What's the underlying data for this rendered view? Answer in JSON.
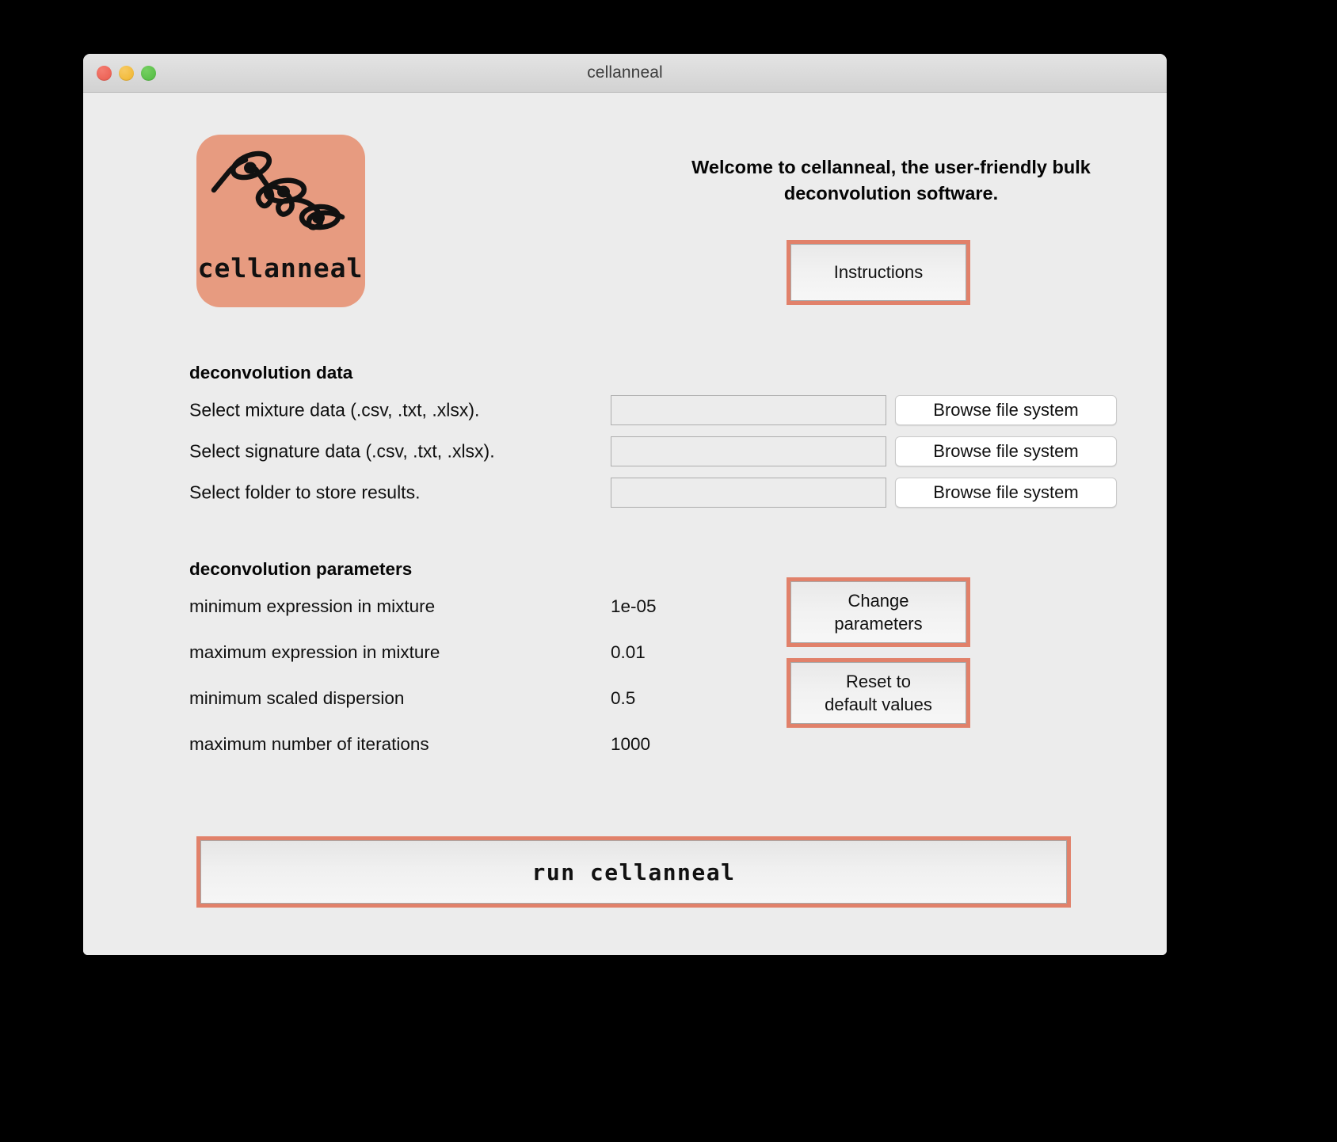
{
  "window": {
    "title": "cellanneal",
    "traffic_lights": [
      {
        "name": "close",
        "color": "#e9594c"
      },
      {
        "name": "minimize",
        "color": "#f0b429"
      },
      {
        "name": "zoom",
        "color": "#4fb93f"
      }
    ]
  },
  "logo": {
    "caption": "cellanneal",
    "background_color": "#e79b80",
    "ink_color": "#111111"
  },
  "welcome": {
    "text": "Welcome to cellanneal, the user-friendly bulk deconvolution software."
  },
  "buttons": {
    "instructions": "Instructions",
    "change_parameters": "Change\nparameters",
    "reset_defaults": "Reset to\ndefault values",
    "run": "run cellanneal",
    "browse": "Browse file system"
  },
  "sections": {
    "data_heading": "deconvolution data",
    "parameters_heading": "deconvolution parameters"
  },
  "data_rows": [
    {
      "label": "Select mixture data (.csv, .txt, .xlsx).",
      "value": "",
      "placeholder": "",
      "browse_label": "Browse file system"
    },
    {
      "label": "Select signature data (.csv, .txt, .xlsx).",
      "value": "",
      "placeholder": "",
      "browse_label": "Browse file system"
    },
    {
      "label": "Select folder to store results.",
      "value": "",
      "placeholder": "",
      "browse_label": "Browse file system"
    }
  ],
  "parameters": [
    {
      "name": "minimum expression in mixture",
      "value": "1e-05"
    },
    {
      "name": "maximum expression in mixture",
      "value": "0.01"
    },
    {
      "name": "minimum scaled dispersion",
      "value": "0.5"
    },
    {
      "name": "maximum number of iterations",
      "value": "1000"
    }
  ],
  "colors": {
    "accent": "#e1816a",
    "window_background": "#ececec",
    "titlebar": "#d9d9d9",
    "logo_salmon": "#e79b80"
  }
}
